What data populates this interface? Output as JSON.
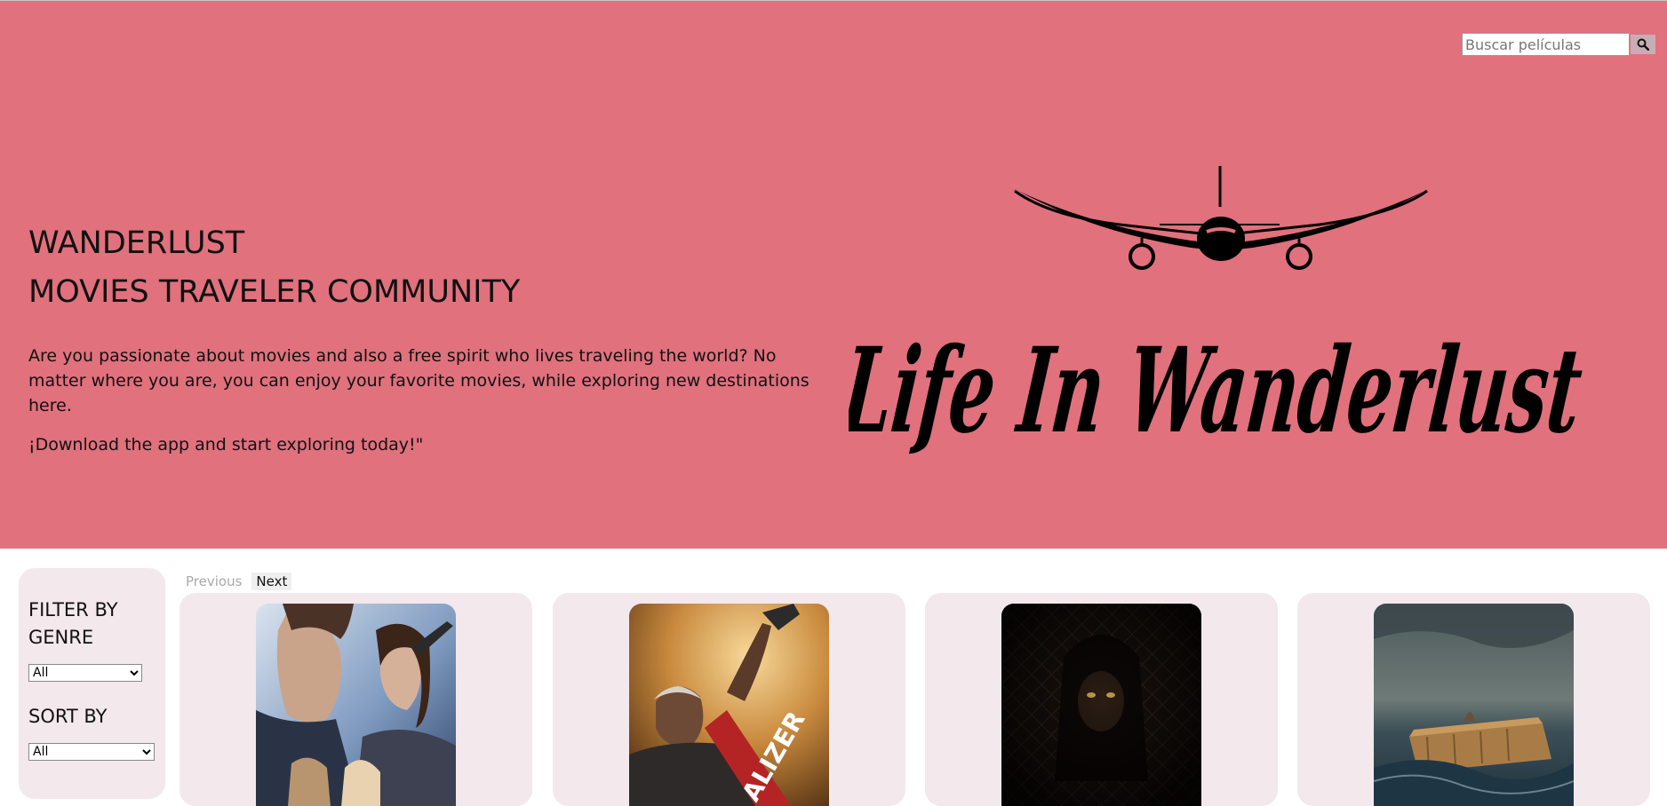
{
  "search": {
    "placeholder": "Buscar películas"
  },
  "hero": {
    "title_line1": "WANDERLUST",
    "title_line2": "MOVIES TRAVELER COMMUNITY",
    "description": "Are you passionate about movies and also a free spirit who lives traveling the world? No matter where you are, you can enjoy your favorite movies, while exploring new destinations here.",
    "cta": "¡Download the app and start exploring today!\"",
    "logo_text": "Life In Wanderlust"
  },
  "filters": {
    "genre_label": "FILTER BY GENRE",
    "genre_selected": "All",
    "sort_label": "SORT BY",
    "sort_selected": "All"
  },
  "pagination": {
    "previous_label": "Previous",
    "next_label": "Next"
  },
  "colors": {
    "hero_bg": "#e0717d",
    "panel_bg": "#f3e8ec",
    "text": "#111111"
  }
}
